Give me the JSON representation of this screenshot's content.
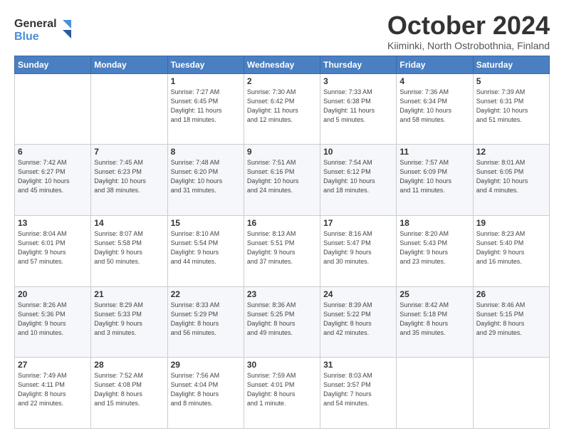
{
  "logo": {
    "line1": "General",
    "line2": "Blue"
  },
  "title": "October 2024",
  "location": "Kiiminki, North Ostrobothnia, Finland",
  "weekdays": [
    "Sunday",
    "Monday",
    "Tuesday",
    "Wednesday",
    "Thursday",
    "Friday",
    "Saturday"
  ],
  "weeks": [
    [
      {
        "day": "",
        "info": ""
      },
      {
        "day": "",
        "info": ""
      },
      {
        "day": "1",
        "info": "Sunrise: 7:27 AM\nSunset: 6:45 PM\nDaylight: 11 hours\nand 18 minutes."
      },
      {
        "day": "2",
        "info": "Sunrise: 7:30 AM\nSunset: 6:42 PM\nDaylight: 11 hours\nand 12 minutes."
      },
      {
        "day": "3",
        "info": "Sunrise: 7:33 AM\nSunset: 6:38 PM\nDaylight: 11 hours\nand 5 minutes."
      },
      {
        "day": "4",
        "info": "Sunrise: 7:36 AM\nSunset: 6:34 PM\nDaylight: 10 hours\nand 58 minutes."
      },
      {
        "day": "5",
        "info": "Sunrise: 7:39 AM\nSunset: 6:31 PM\nDaylight: 10 hours\nand 51 minutes."
      }
    ],
    [
      {
        "day": "6",
        "info": "Sunrise: 7:42 AM\nSunset: 6:27 PM\nDaylight: 10 hours\nand 45 minutes."
      },
      {
        "day": "7",
        "info": "Sunrise: 7:45 AM\nSunset: 6:23 PM\nDaylight: 10 hours\nand 38 minutes."
      },
      {
        "day": "8",
        "info": "Sunrise: 7:48 AM\nSunset: 6:20 PM\nDaylight: 10 hours\nand 31 minutes."
      },
      {
        "day": "9",
        "info": "Sunrise: 7:51 AM\nSunset: 6:16 PM\nDaylight: 10 hours\nand 24 minutes."
      },
      {
        "day": "10",
        "info": "Sunrise: 7:54 AM\nSunset: 6:12 PM\nDaylight: 10 hours\nand 18 minutes."
      },
      {
        "day": "11",
        "info": "Sunrise: 7:57 AM\nSunset: 6:09 PM\nDaylight: 10 hours\nand 11 minutes."
      },
      {
        "day": "12",
        "info": "Sunrise: 8:01 AM\nSunset: 6:05 PM\nDaylight: 10 hours\nand 4 minutes."
      }
    ],
    [
      {
        "day": "13",
        "info": "Sunrise: 8:04 AM\nSunset: 6:01 PM\nDaylight: 9 hours\nand 57 minutes."
      },
      {
        "day": "14",
        "info": "Sunrise: 8:07 AM\nSunset: 5:58 PM\nDaylight: 9 hours\nand 50 minutes."
      },
      {
        "day": "15",
        "info": "Sunrise: 8:10 AM\nSunset: 5:54 PM\nDaylight: 9 hours\nand 44 minutes."
      },
      {
        "day": "16",
        "info": "Sunrise: 8:13 AM\nSunset: 5:51 PM\nDaylight: 9 hours\nand 37 minutes."
      },
      {
        "day": "17",
        "info": "Sunrise: 8:16 AM\nSunset: 5:47 PM\nDaylight: 9 hours\nand 30 minutes."
      },
      {
        "day": "18",
        "info": "Sunrise: 8:20 AM\nSunset: 5:43 PM\nDaylight: 9 hours\nand 23 minutes."
      },
      {
        "day": "19",
        "info": "Sunrise: 8:23 AM\nSunset: 5:40 PM\nDaylight: 9 hours\nand 16 minutes."
      }
    ],
    [
      {
        "day": "20",
        "info": "Sunrise: 8:26 AM\nSunset: 5:36 PM\nDaylight: 9 hours\nand 10 minutes."
      },
      {
        "day": "21",
        "info": "Sunrise: 8:29 AM\nSunset: 5:33 PM\nDaylight: 9 hours\nand 3 minutes."
      },
      {
        "day": "22",
        "info": "Sunrise: 8:33 AM\nSunset: 5:29 PM\nDaylight: 8 hours\nand 56 minutes."
      },
      {
        "day": "23",
        "info": "Sunrise: 8:36 AM\nSunset: 5:25 PM\nDaylight: 8 hours\nand 49 minutes."
      },
      {
        "day": "24",
        "info": "Sunrise: 8:39 AM\nSunset: 5:22 PM\nDaylight: 8 hours\nand 42 minutes."
      },
      {
        "day": "25",
        "info": "Sunrise: 8:42 AM\nSunset: 5:18 PM\nDaylight: 8 hours\nand 35 minutes."
      },
      {
        "day": "26",
        "info": "Sunrise: 8:46 AM\nSunset: 5:15 PM\nDaylight: 8 hours\nand 29 minutes."
      }
    ],
    [
      {
        "day": "27",
        "info": "Sunrise: 7:49 AM\nSunset: 4:11 PM\nDaylight: 8 hours\nand 22 minutes."
      },
      {
        "day": "28",
        "info": "Sunrise: 7:52 AM\nSunset: 4:08 PM\nDaylight: 8 hours\nand 15 minutes."
      },
      {
        "day": "29",
        "info": "Sunrise: 7:56 AM\nSunset: 4:04 PM\nDaylight: 8 hours\nand 8 minutes."
      },
      {
        "day": "30",
        "info": "Sunrise: 7:59 AM\nSunset: 4:01 PM\nDaylight: 8 hours\nand 1 minute."
      },
      {
        "day": "31",
        "info": "Sunrise: 8:03 AM\nSunset: 3:57 PM\nDaylight: 7 hours\nand 54 minutes."
      },
      {
        "day": "",
        "info": ""
      },
      {
        "day": "",
        "info": ""
      }
    ]
  ]
}
